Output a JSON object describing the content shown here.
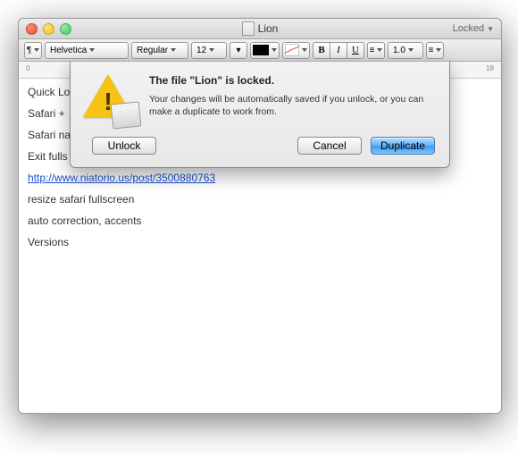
{
  "window": {
    "title": "Lion",
    "locked_label": "Locked"
  },
  "toolbar": {
    "font_family": "Helvetica",
    "font_style": "Regular",
    "font_size": "12",
    "spacing": "1.0"
  },
  "ruler": {
    "start": "0",
    "end": "18"
  },
  "document": {
    "lines": [
      "Quick Lo",
      "Safari + ",
      "Safari na",
      "Exit fulls"
    ],
    "link_text": "http://www.niatorio.us/post/3500880763",
    "lines_after": [
      "resize safari fullscreen",
      "auto correction, accents",
      "Versions"
    ]
  },
  "dialog": {
    "title": "The file \"Lion\" is locked.",
    "message": "Your changes will be automatically saved if you unlock, or you can make a duplicate to work from.",
    "unlock": "Unlock",
    "cancel": "Cancel",
    "duplicate": "Duplicate"
  }
}
